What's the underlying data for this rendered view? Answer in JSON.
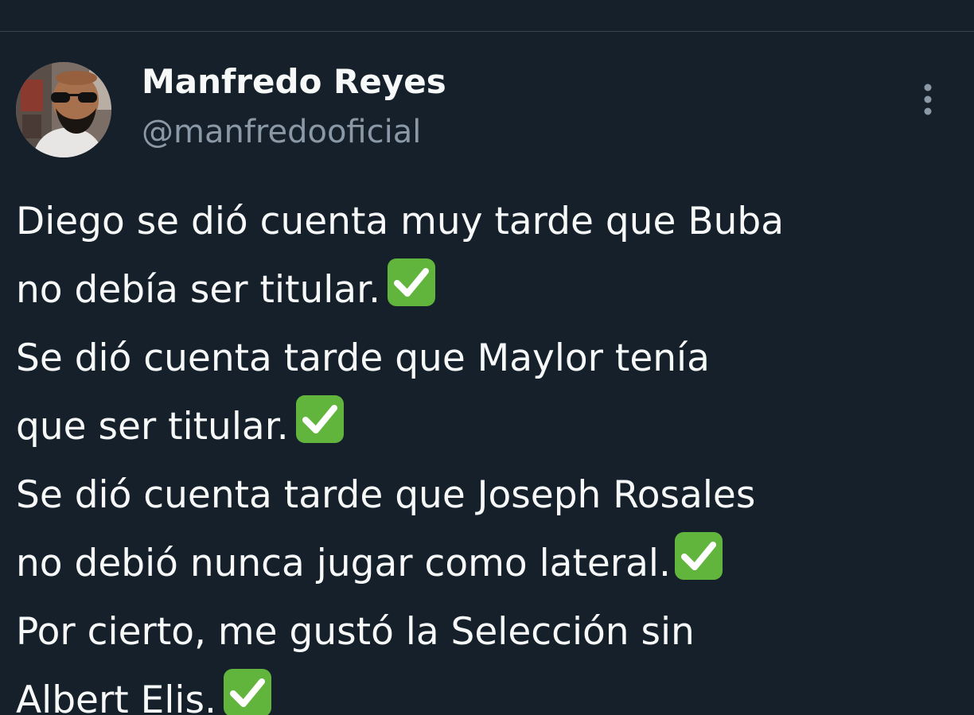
{
  "author": {
    "name": "Manfredo Reyes",
    "handle": "@manfredooficial"
  },
  "tweet": {
    "lines": [
      "Diego se dió cuenta muy tarde que Buba",
      "no debía ser titular.",
      "Se dió cuenta tarde que Maylor tenía",
      "que ser titular.",
      "Se dió cuenta tarde que Joseph Rosales",
      "no debió nunca jugar como lateral.",
      "Por cierto, me gustó la Selección sin",
      "Albert Elis."
    ]
  },
  "icons": {
    "more": "more-vertical-icon",
    "check": "white-check-mark-emoji"
  },
  "colors": {
    "background": "#15202b",
    "text": "#f7f9f9",
    "secondary_text": "#8b98a5",
    "check_green": "#62b53c"
  }
}
